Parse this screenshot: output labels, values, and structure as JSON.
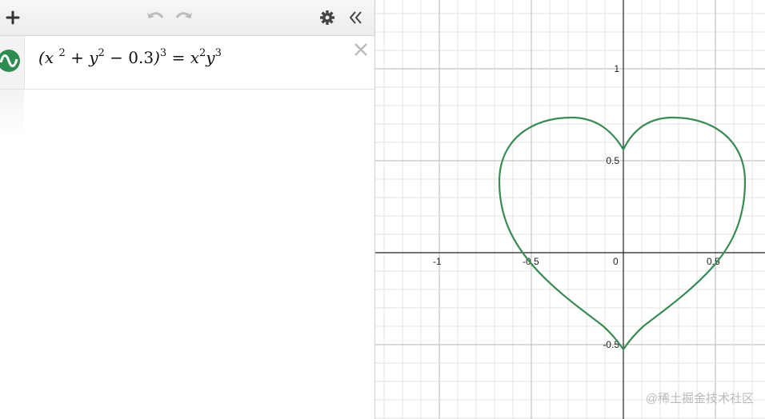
{
  "toolbar": {
    "add_icon": "plus-icon",
    "undo_icon": "undo-icon",
    "redo_icon": "redo-icon",
    "settings_icon": "gear-icon",
    "collapse_icon": "double-chevron-left-icon"
  },
  "expression": {
    "color": "#2d8c4f",
    "icon": "wave-icon",
    "parts": {
      "open": "(",
      "x": "x",
      "e1": "2",
      "plus": "+",
      "y": "y",
      "e2": "2",
      "minus": "−",
      "const": "0.3",
      "close": ")",
      "e3": "3",
      "eq": "=",
      "rx": "x",
      "e4": "2",
      "ry": "y",
      "e5": "3"
    },
    "delete_icon": "close-icon"
  },
  "graph": {
    "curve_color": "#3a8a55",
    "x_ticks": [
      "-1",
      "-0.5",
      "0",
      "0.5"
    ],
    "y_ticks": [
      "1",
      "0.5",
      "-0.5"
    ]
  },
  "watermark": "@稀土掘金技术社区"
}
